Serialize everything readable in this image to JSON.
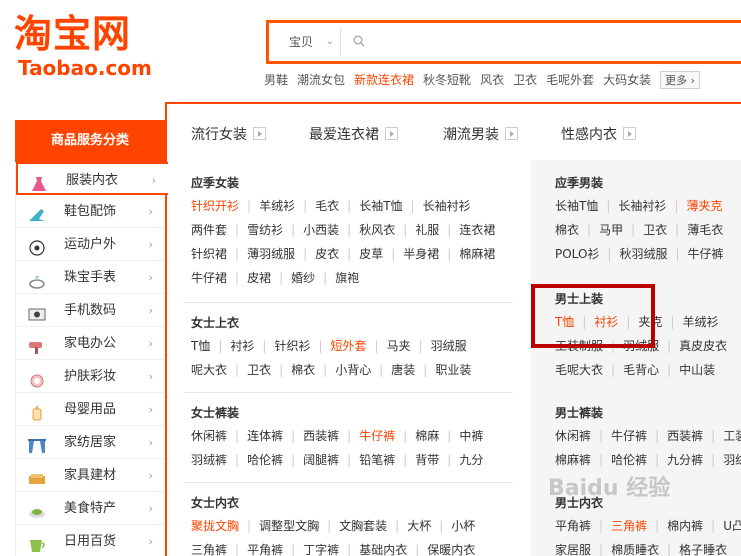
{
  "logo": {
    "cn": "淘宝网",
    "en": "Taobao.com"
  },
  "search": {
    "type_label": "宝贝",
    "value": ""
  },
  "hotwords": [
    "男鞋",
    "潮流女包",
    "新款连衣裙",
    "秋冬短靴",
    "风衣",
    "卫衣",
    "毛呢外套",
    "大码女装"
  ],
  "hotwords_more": "更多",
  "hot_index": 2,
  "sidebar": {
    "title": "商品服务分类",
    "items": [
      {
        "label": "服装内衣",
        "icon": "dress-icon"
      },
      {
        "label": "鞋包配饰",
        "icon": "high-heel-icon"
      },
      {
        "label": "运动户外",
        "icon": "soccer-ball-icon"
      },
      {
        "label": "珠宝手表",
        "icon": "ring-icon"
      },
      {
        "label": "手机数码",
        "icon": "camera-icon"
      },
      {
        "label": "家电办公",
        "icon": "hair-dryer-icon"
      },
      {
        "label": "护肤彩妆",
        "icon": "compact-icon"
      },
      {
        "label": "母婴用品",
        "icon": "baby-bottle-icon"
      },
      {
        "label": "家纺居家",
        "icon": "curtain-icon"
      },
      {
        "label": "家具建材",
        "icon": "sofa-icon"
      },
      {
        "label": "美食特产",
        "icon": "food-icon"
      },
      {
        "label": "日用百货",
        "icon": "cup-icon"
      }
    ]
  },
  "tabs": [
    "流行女装",
    "最爱连衣裙",
    "潮流男装",
    "性感内衣"
  ],
  "left_groups": [
    {
      "title": "应季女装",
      "lines": [
        [
          "针织开衫",
          "羊绒衫",
          "毛衣",
          "长袖T恤",
          "长袖衬衫"
        ],
        [
          "两件套",
          "雪纺衫",
          "小西装",
          "秋风衣",
          "礼服",
          "连衣裙"
        ],
        [
          "针织裙",
          "薄羽绒服",
          "皮衣",
          "皮草",
          "半身裙",
          "棉麻裙"
        ],
        [
          "牛仔裙",
          "皮裙",
          "婚纱",
          "旗袍"
        ]
      ],
      "hot": [
        "针织开衫"
      ]
    },
    {
      "title": "女士上衣",
      "lines": [
        [
          "T恤",
          "衬衫",
          "针织衫",
          "短外套",
          "马夹",
          "羽绒服"
        ],
        [
          "呢大衣",
          "卫衣",
          "棉衣",
          "小背心",
          "唐装",
          "职业装"
        ]
      ],
      "hot": [
        "短外套"
      ]
    },
    {
      "title": "女士裤装",
      "lines": [
        [
          "休闲裤",
          "连体裤",
          "西装裤",
          "牛仔裤",
          "棉麻",
          "中裤"
        ],
        [
          "羽绒裤",
          "哈伦裤",
          "阔腿裤",
          "铅笔裤",
          "背带",
          "九分"
        ]
      ],
      "hot": [
        "牛仔裤"
      ]
    },
    {
      "title": "女士内衣",
      "lines": [
        [
          "聚拢文胸",
          "调整型文胸",
          "文胸套装",
          "大杯",
          "小杯"
        ],
        [
          "三角裤",
          "平角裤",
          "丁字裤",
          "基础内衣",
          "保暖内衣"
        ]
      ],
      "hot": [
        "聚拢文胸"
      ]
    }
  ],
  "right_groups": [
    {
      "title": "应季男装",
      "lines": [
        [
          "长袖T恤",
          "长袖衬衫",
          "薄夹克"
        ],
        [
          "棉衣",
          "马甲",
          "卫衣",
          "薄毛衣"
        ],
        [
          "POLO衫",
          "秋羽绒服",
          "牛仔裤"
        ]
      ],
      "hot": [
        "薄夹克"
      ]
    },
    {
      "title": "男士上装",
      "lines": [
        [
          "T恤",
          "衬衫",
          "夹克",
          "羊绒衫"
        ],
        [
          "工装制服",
          "羽绒服",
          "真皮皮衣"
        ],
        [
          "毛呢大衣",
          "毛背心",
          "中山装"
        ]
      ],
      "hot": [
        "T恤",
        "衬衫"
      ]
    },
    {
      "title": "男士裤装",
      "lines": [
        [
          "休闲裤",
          "牛仔裤",
          "西装裤",
          "工装"
        ],
        [
          "棉麻裤",
          "哈伦裤",
          "九分裤",
          "羽绒"
        ]
      ],
      "hot": []
    },
    {
      "title": "男士内衣",
      "lines": [
        [
          "平角裤",
          "三角裤",
          "棉内裤",
          "U凸内"
        ],
        [
          "家居服",
          "棉质睡衣",
          "格子睡衣"
        ]
      ],
      "hot": [
        "三角裤"
      ]
    }
  ],
  "watermark": "Baidu 经验",
  "colors": {
    "accent": "#ff4400",
    "highlight": "#bb0000"
  }
}
